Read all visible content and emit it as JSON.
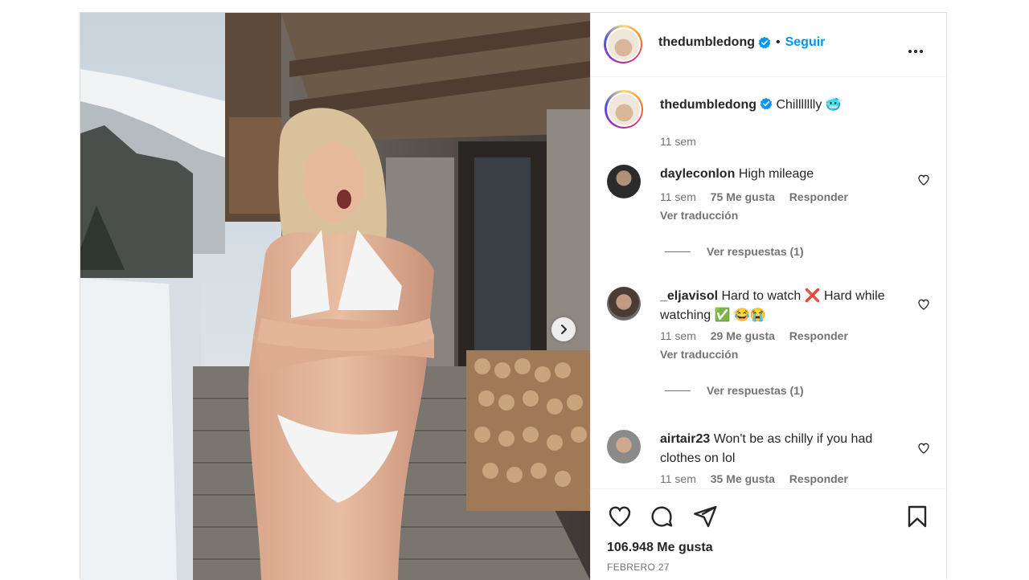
{
  "post": {
    "username": "thedumbledong",
    "separator": "•",
    "follow_label": "Seguir"
  },
  "caption": {
    "username": "thedumbledong",
    "text": "Chillllllly",
    "emoji": "🥶",
    "time": "11 sem"
  },
  "comments": [
    {
      "username": "dayleconlon",
      "text": "High mileage",
      "time": "11 sem",
      "likes": "75 Me gusta",
      "reply_label": "Responder",
      "translate_label": "Ver traducción",
      "replies_label": "Ver respuestas (1)"
    },
    {
      "username": "_eljavisol",
      "text": "Hard to watch ❌ Hard while watching ✅ 😂😭",
      "time": "11 sem",
      "likes": "29 Me gusta",
      "reply_label": "Responder",
      "translate_label": "Ver traducción",
      "replies_label": "Ver respuestas (1)"
    },
    {
      "username": "airtair23",
      "text": "Won't be as chilly if you had clothes on lol",
      "time": "11 sem",
      "likes": "35 Me gusta",
      "reply_label": "Responder"
    }
  ],
  "footer": {
    "likes_total": "106.948 Me gusta",
    "date": "FEBRERO 27"
  },
  "icons": [
    "verified-badge-icon",
    "more-options-icon",
    "heart-icon",
    "comment-icon",
    "share-icon",
    "bookmark-icon",
    "chevron-right-icon"
  ],
  "colors": {
    "accent": "#0095f6",
    "verified": "#0095f6",
    "text": "#262626",
    "muted": "#737373",
    "border": "#dbdbdb"
  }
}
